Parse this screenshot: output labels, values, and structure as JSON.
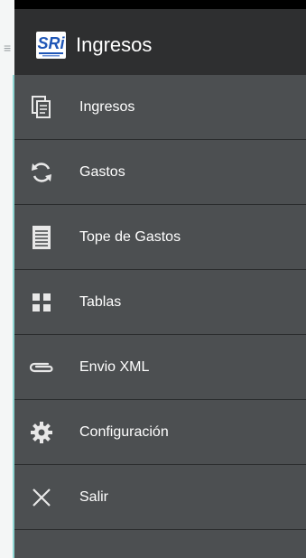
{
  "header": {
    "title": "Ingresos",
    "logo_text": "SRi"
  },
  "menu": {
    "items": [
      {
        "label": "Ingresos",
        "icon": "document-copy-icon"
      },
      {
        "label": "Gastos",
        "icon": "refresh-icon"
      },
      {
        "label": "Tope de Gastos",
        "icon": "list-document-icon"
      },
      {
        "label": "Tablas",
        "icon": "grid-icon"
      },
      {
        "label": "Envio XML",
        "icon": "paperclip-icon"
      },
      {
        "label": "Configuración",
        "icon": "gear-icon"
      },
      {
        "label": "Salir",
        "icon": "close-icon"
      }
    ]
  },
  "colors": {
    "drawer_bg": "#4c4f51",
    "header_bg": "#2e2f30",
    "divider": "#2a2c2d",
    "text": "#ffffff",
    "accent_rail": "#8fd7d4"
  }
}
